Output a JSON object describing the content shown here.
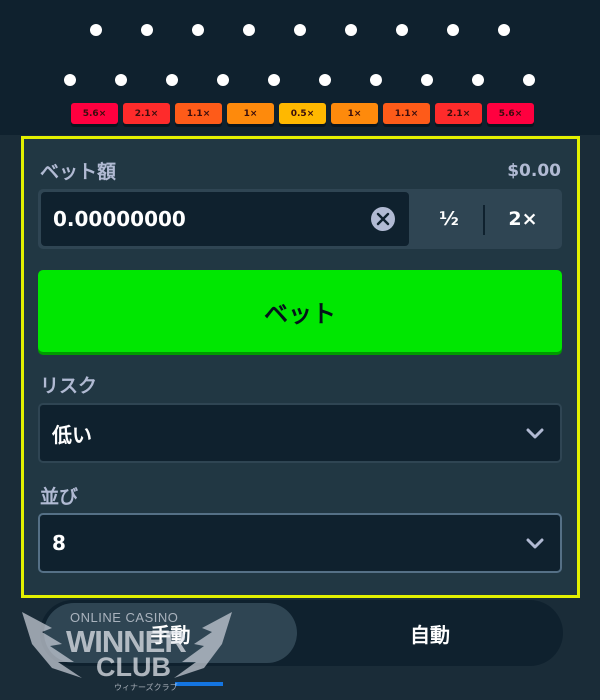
{
  "board": {
    "multipliers": [
      {
        "label": "5.6×",
        "tone": "m1"
      },
      {
        "label": "2.1×",
        "tone": "m2"
      },
      {
        "label": "1.1×",
        "tone": "m3"
      },
      {
        "label": "1×",
        "tone": "m4"
      },
      {
        "label": "0.5×",
        "tone": "m5"
      },
      {
        "label": "1×",
        "tone": "m4"
      },
      {
        "label": "1.1×",
        "tone": "m3"
      },
      {
        "label": "2.1×",
        "tone": "m2"
      },
      {
        "label": "5.6×",
        "tone": "m1"
      }
    ]
  },
  "bet": {
    "label": "ベット額",
    "usd_amount": "$0.00",
    "value": "0.00000000",
    "half_label": "½",
    "double_label": "2×",
    "button_label": "ベット"
  },
  "risk": {
    "label": "リスク",
    "selected": "低い"
  },
  "rows": {
    "label": "並び",
    "selected": "8"
  },
  "tabs": {
    "manual": "手動",
    "auto": "自動"
  },
  "watermark": {
    "line1": "ONLINE CASINO",
    "line2": "WINNER",
    "line3": "CLUB",
    "line4": "ウィナーズクラブ"
  },
  "colors": {
    "background": "#1a2c38",
    "panel_highlight": "#e3f000",
    "bet_button": "#00e701",
    "tab_active_indicator": "#1475e1"
  },
  "icons": {
    "clear": "close-circle-icon",
    "dropdown": "chevron-down-icon"
  }
}
